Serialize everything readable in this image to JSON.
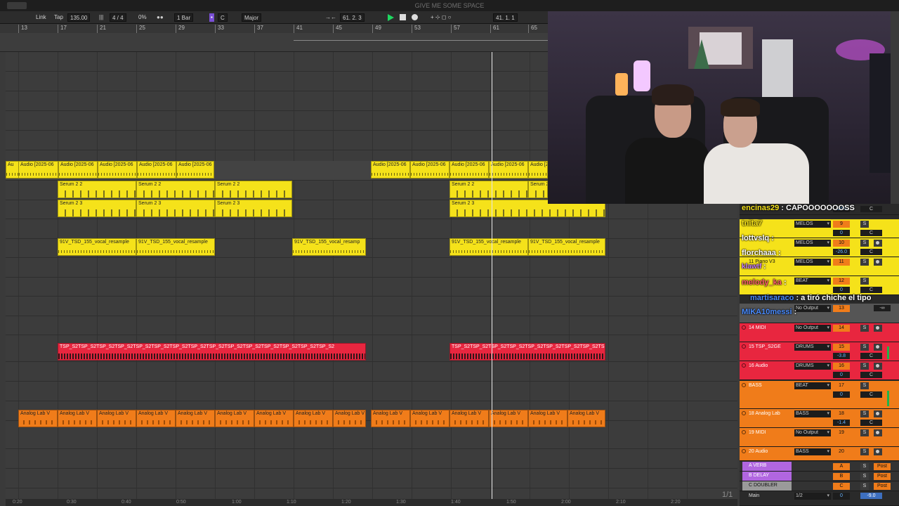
{
  "window": {
    "title": "GIVE ME SOME SPACE"
  },
  "transport": {
    "link": "Link",
    "tap": "Tap",
    "tempo": "135.00",
    "meter_icon": "|||",
    "signature": "4 / 4",
    "swing": "0%",
    "metronome": "●●",
    "quantize": "1 Bar",
    "key_icon": "▪",
    "key": "C",
    "scale": "Major",
    "follow": "→←",
    "position": "61.  2.  3",
    "end_position": "41.  1.  1",
    "tools": "+ ⊹ ◻ ○"
  },
  "ruler": {
    "bars": [
      "13",
      "17",
      "21",
      "25",
      "29",
      "33",
      "37",
      "41",
      "45",
      "49",
      "53",
      "57",
      "61",
      "65"
    ]
  },
  "timebar": {
    "times": [
      "0:20",
      "0:30",
      "0:40",
      "0:50",
      "1:00",
      "1:10",
      "1:20",
      "1:30",
      "1:40",
      "1:50",
      "2:00",
      "2:10",
      "2:20"
    ]
  },
  "clips": {
    "audio_short": "Au",
    "audio": "Audio [2025-06",
    "serum22": "Serum 2 2",
    "serum23": "Serum 2 3",
    "vocal": "91V_TSD_155_vocal_resample",
    "vocal_short": "91V_TSD_155_vocal_resamp",
    "tsp": "TSP_S2TSP_S2TSP_S2TSP_S2TSP_S2TSP_S2TSP_S2TSP_S2TSP_S2TSP_S2TSP_S2TSP_S2TSP_S2TSP_S2TSP_S2",
    "tsp2": "TSP_S2TSP_S2TSP_S2TSP_S2TSP_S2TSP_S2TSP_S2TSP_S2TSP_S2TSP_S2",
    "analog": "Analog Lab V"
  },
  "mixer": {
    "channels": [
      {
        "name": "",
        "route": "",
        "num": "",
        "vol": "-26.0",
        "pan": "C"
      },
      {
        "name": "",
        "route": "MELOS",
        "num": "9",
        "vol": "0",
        "pan": "C"
      },
      {
        "name": "",
        "route": "MELOS",
        "num": "10",
        "vol": "-26.0",
        "pan": "C"
      },
      {
        "name": "11 Piano V3",
        "route": "MELOS",
        "num": "11",
        "vol": "",
        "pan": ""
      },
      {
        "name": "",
        "route": "BEAT",
        "num": "12",
        "vol": "0",
        "pan": "C"
      },
      {
        "name": "",
        "route": "No Output",
        "num": "13",
        "vol": "",
        "pan": "-∞"
      },
      {
        "name": "14 MIDI",
        "route": "No Output",
        "num": "14",
        "vol": "",
        "pan": ""
      },
      {
        "name": "15 TSP_S2GE",
        "route": "DRUMS",
        "num": "15",
        "vol": "-3.8",
        "pan": "C"
      },
      {
        "name": "16 Audio",
        "route": "DRUMS",
        "num": "16",
        "vol": "0",
        "pan": "C"
      },
      {
        "name": "BASS",
        "route": "BEAT",
        "num": "17",
        "vol": "0",
        "pan": "C"
      },
      {
        "name": "18 Analog Lab",
        "route": "BASS",
        "num": "18",
        "vol": "-1.4",
        "pan": "C"
      },
      {
        "name": "19 MIDI",
        "route": "No Output",
        "num": "19",
        "vol": "",
        "pan": ""
      },
      {
        "name": "20 Audio",
        "route": "BASS",
        "num": "20",
        "vol": "",
        "pan": ""
      },
      {
        "name": "A VERB",
        "route": "",
        "num": "A",
        "vol": "",
        "pan": "Post"
      },
      {
        "name": "B DELAY",
        "route": "",
        "num": "B",
        "vol": "",
        "pan": "Post"
      },
      {
        "name": "C DOUBLER",
        "route": "",
        "num": "C",
        "vol": "",
        "pan": "Post"
      },
      {
        "name": "Main",
        "route": "1/2",
        "num": "0",
        "vol": "-9.0",
        "pan": ""
      }
    ],
    "minus_inf": "-∞",
    "solo": "S"
  },
  "chat": [
    {
      "user": "encinas29",
      "sep": ":",
      "text": "CAPOOOOOOOSS",
      "color": "#f5e21a"
    },
    {
      "user": "tnita7",
      "sep": "",
      "text": "",
      "color": "#f5e21a"
    },
    {
      "user": "lottvslq",
      "sep": ":",
      "text": "",
      "color": "#ffffff"
    },
    {
      "user": "florchaaa",
      "sep": ":",
      "text": "",
      "color": "#ffffff"
    },
    {
      "user": "klawtf",
      "sep": ":",
      "text": "",
      "color": "#c57bff"
    },
    {
      "user": "melody_ka",
      "sep": ":",
      "text": "",
      "color": "#ff5a6e"
    },
    {
      "user": "martisaraco",
      "sep": ":",
      "text": "a tiró chiche el tipo",
      "color": "#4a8cff"
    },
    {
      "user": "MIKA10messi",
      "sep": ":",
      "text": "",
      "color": "#4a8cff"
    }
  ],
  "page_indicator": "1/1",
  "colors": {
    "yellow": "#f5e21a",
    "red": "#e8263f",
    "orange": "#f07c1a",
    "play": "#1ed760"
  }
}
